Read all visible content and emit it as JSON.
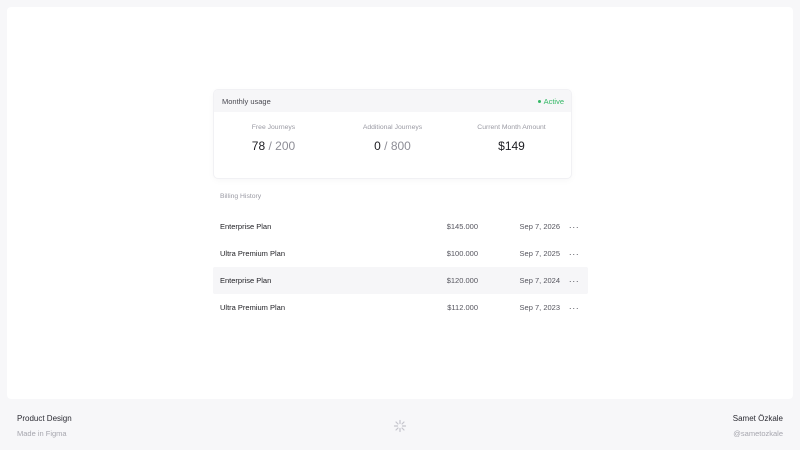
{
  "usage": {
    "title": "Monthly usage",
    "status": "Active",
    "stats": [
      {
        "label": "Free Journeys",
        "value": "78",
        "total": "/ 200"
      },
      {
        "label": "Additional Journeys",
        "value": "0",
        "total": "/ 800"
      },
      {
        "label": "Current Month Amount",
        "value": "$149",
        "total": ""
      }
    ]
  },
  "billing": {
    "title": "Billing History",
    "rows": [
      {
        "plan": "Enterprise Plan",
        "amount": "$145.000",
        "date": "Sep 7, 2026"
      },
      {
        "plan": "Ultra Premium Plan",
        "amount": "$100.000",
        "date": "Sep 7, 2025"
      },
      {
        "plan": "Enterprise Plan",
        "amount": "$120.000",
        "date": "Sep 7, 2024"
      },
      {
        "plan": "Ultra Premium Plan",
        "amount": "$112.000",
        "date": "Sep 7, 2023"
      }
    ],
    "more_glyph": "···"
  },
  "footer": {
    "left_title": "Product Design",
    "left_sub": "Made in Figma",
    "right_title": "Samet Özkale",
    "right_sub": "@sametozkale"
  },
  "colors": {
    "accent_active": "#34b866",
    "highlight_row": "#f6f6f8"
  }
}
